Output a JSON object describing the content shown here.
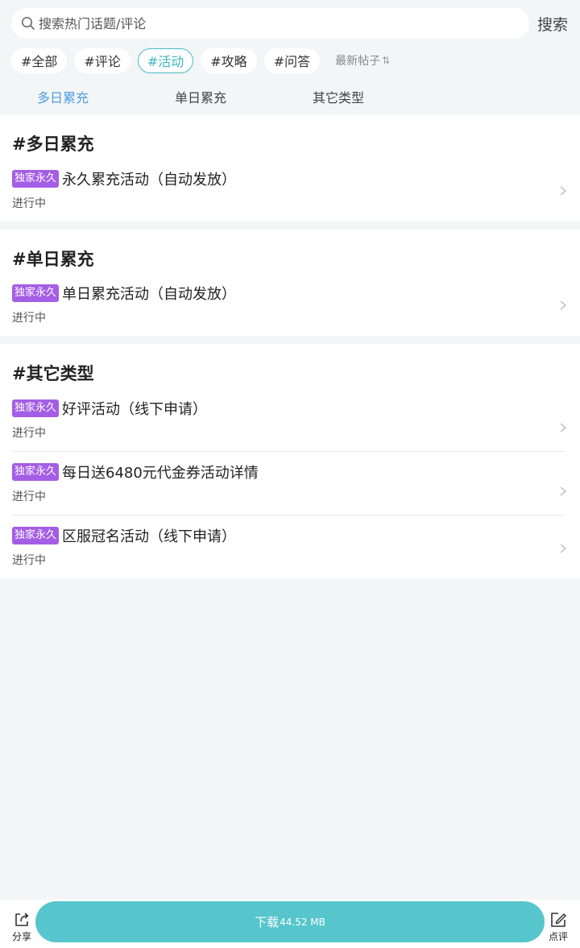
{
  "search": {
    "placeholder": "搜索热门话题/评论",
    "button_label": "搜索"
  },
  "chips": [
    {
      "label": "#全部",
      "active": false
    },
    {
      "label": "#评论",
      "active": false
    },
    {
      "label": "#活动",
      "active": true
    },
    {
      "label": "#攻略",
      "active": false
    },
    {
      "label": "#问答",
      "active": false
    }
  ],
  "sort": {
    "label": "最新帖子",
    "icon": "sort-arrows-icon"
  },
  "tabs": [
    {
      "label": "多日累充",
      "active": true
    },
    {
      "label": "单日累充",
      "active": false
    },
    {
      "label": "其它类型",
      "active": false
    }
  ],
  "sections": [
    {
      "title": "#多日累充",
      "items": [
        {
          "badge": "独家永久",
          "title": "永久累充活动（自动发放）",
          "status": "进行中"
        }
      ]
    },
    {
      "title": "#单日累充",
      "items": [
        {
          "badge": "独家永久",
          "title": "单日累充活动（自动发放）",
          "status": "进行中"
        }
      ]
    },
    {
      "title": "#其它类型",
      "items": [
        {
          "badge": "独家永久",
          "title": "好评活动（线下申请）",
          "status": "进行中"
        },
        {
          "badge": "独家永久",
          "title": "每日送6480元代金券活动详情",
          "status": "进行中"
        },
        {
          "badge": "独家永久",
          "title": "区服冠名活动（线下申请）",
          "status": "进行中"
        }
      ]
    }
  ],
  "bottom": {
    "share_label": "分享",
    "download_label": "下载",
    "download_size": "44.52 MB",
    "review_label": "点评"
  },
  "colors": {
    "accent": "#56c5cc",
    "chip_active": "#49bcc3",
    "tab_active": "#4a9fe0",
    "badge": "#a45ee5",
    "background": "#f4f5f7"
  }
}
